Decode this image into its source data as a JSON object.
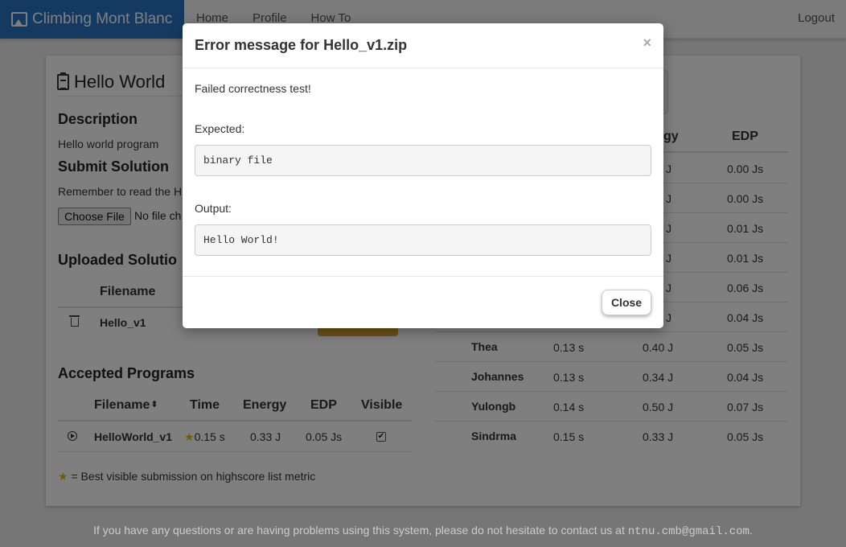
{
  "navbar": {
    "brand": "Climbing Mont Blanc",
    "links": [
      "Home",
      "Profile",
      "How To"
    ],
    "logout": "Logout"
  },
  "page": {
    "title": "Hello World",
    "description_heading": "Description",
    "description": "Hello world program",
    "submit_heading": "Submit Solution",
    "submit_note": "Remember to read the H",
    "choose_file": "Choose File",
    "no_file": "No file ch",
    "uploaded_heading": "Uploaded Solutio",
    "uploaded_columns": [
      "Filename"
    ],
    "uploaded_rows": [
      {
        "filename": "Hello_v1"
      }
    ],
    "accepted_heading": "Accepted Programs",
    "accepted_columns": [
      "Filename",
      "Time",
      "Energy",
      "EDP",
      "Visible"
    ],
    "accepted_rows": [
      {
        "filename": "HelloWorld_v1",
        "star": "★",
        "time": "0.15 s",
        "energy": "0.33 J",
        "edp": "0.05 Js",
        "visible": "✔"
      }
    ],
    "legend_star": "★",
    "legend": " = Best visible submission on highscore list metric"
  },
  "highscore": {
    "columns": [
      "gy",
      "EDP"
    ],
    "partial_rows": [
      {
        "energy": "J",
        "edp": "0.00 Js"
      },
      {
        "energy": "J",
        "edp": "0.00 Js"
      },
      {
        "energy": "J",
        "edp": "0.01 Js"
      },
      {
        "energy": "J",
        "edp": "0.01 Js"
      },
      {
        "energy": "J",
        "edp": "0.06 Js"
      },
      {
        "energy": "J",
        "edp": "0.04 Js"
      }
    ],
    "rows": [
      {
        "name": "Thea",
        "time": "0.13 s",
        "energy": "0.40 J",
        "edp": "0.05 Js"
      },
      {
        "name": "Johannes",
        "time": "0.13 s",
        "energy": "0.34 J",
        "edp": "0.04 Js"
      },
      {
        "name": "Yulongb",
        "time": "0.14 s",
        "energy": "0.50 J",
        "edp": "0.07 Js"
      },
      {
        "name": "Sindrma",
        "time": "0.15 s",
        "energy": "0.33 J",
        "edp": "0.05 Js"
      }
    ]
  },
  "footer": {
    "text": "If you have any questions or are having problems using this system, please do not hesitate to contact us at ",
    "email": "ntnu.cmb@gmail.com",
    "end": "."
  },
  "modal": {
    "title": "Error message for Hello_v1.zip",
    "close_x": "×",
    "message": "Failed correctness test!",
    "expected_label": "Expected:",
    "expected_value": "binary file",
    "output_label": "Output:",
    "output_value": "Hello World!",
    "close_button": "Close"
  }
}
